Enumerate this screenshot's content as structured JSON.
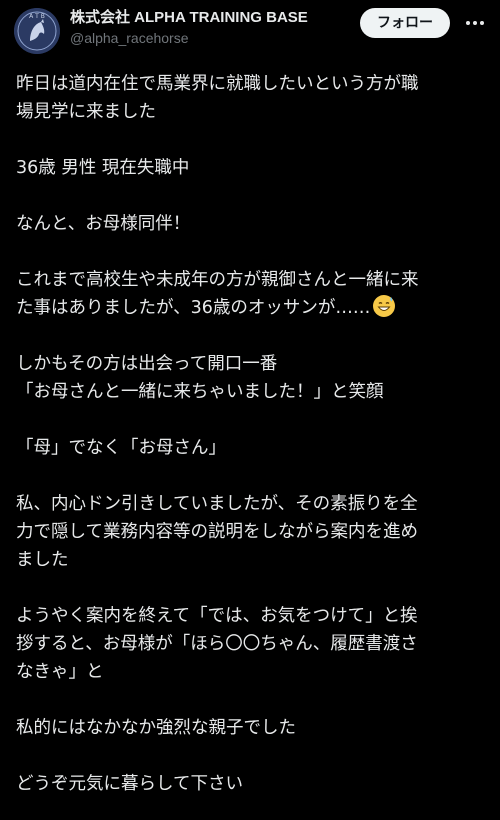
{
  "header": {
    "display_name": "株式会社 ALPHA TRAINING BASE",
    "handle": "@alpha_racehorse",
    "follow_label": "フォロー",
    "avatar_text": "A T B"
  },
  "tweet": {
    "p1": "昨日は道内在住で馬業界に就職したいという方が職\n場見学に来ました",
    "p2": "36歳 男性 現在失職中",
    "p3": "なんと、お母様同伴！",
    "p4": "これまで高校生や未成年の方が親御さんと一緒に来\nた事はありましたが、36歳のオッサンが……",
    "p4_emoji": "grinning-sweat-emoji",
    "p5": "しかもその方は出会って開口一番\n「お母さんと一緒に来ちゃいました！」と笑顔",
    "p6": "「母」でなく「お母さん」",
    "p7": "私、内心ドン引きしていましたが、その素振りを全\n力で隠して業務内容等の説明をしながら案内を進め\nました",
    "p8": "ようやく案内を終えて「では、お気をつけて」と挨\n拶すると、お母様が「ほら〇〇ちゃん、履歴書渡さ\nなきゃ」と",
    "p9": "私的にはなかなか強烈な親子でした",
    "p10": "どうぞ元気に暮らして下さい"
  },
  "icons": {
    "more": "more-dots-icon"
  }
}
